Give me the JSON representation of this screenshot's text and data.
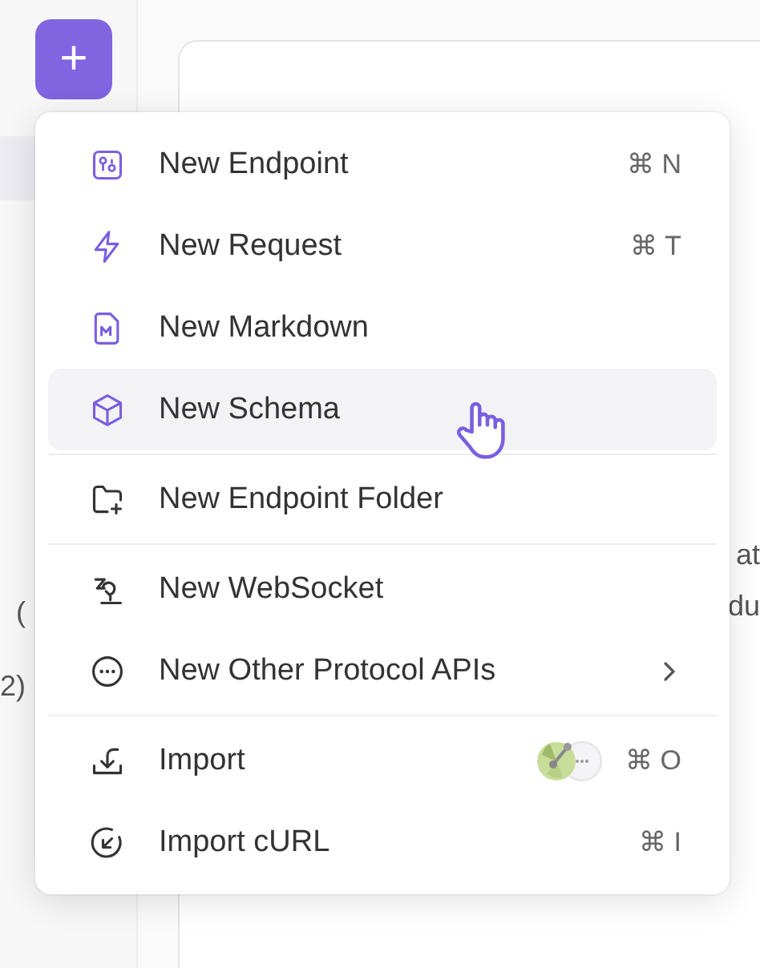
{
  "add_button": {
    "label": "+"
  },
  "overview": {
    "fragments": [
      "at",
      "du"
    ]
  },
  "sidebar": {
    "fragments": [
      "(",
      "2)"
    ]
  },
  "menu": {
    "groups": [
      {
        "items": [
          {
            "kind": "shortcut",
            "label": "New Endpoint",
            "shortcut": "⌘ N",
            "selected": false
          },
          {
            "kind": "shortcut",
            "label": "New Request",
            "shortcut": "⌘ T",
            "selected": false
          },
          {
            "kind": "plain",
            "label": "New Markdown",
            "selected": false
          },
          {
            "kind": "plain",
            "label": "New Schema",
            "selected": true
          }
        ]
      },
      {
        "items": [
          {
            "kind": "plain",
            "label": "New Endpoint Folder",
            "selected": false
          }
        ]
      },
      {
        "items": [
          {
            "kind": "plain",
            "label": "New WebSocket",
            "selected": false
          },
          {
            "kind": "submenu",
            "label": "New Other Protocol APIs",
            "selected": false
          }
        ]
      },
      {
        "items": [
          {
            "kind": "apps",
            "label": "Import",
            "shortcut": "⌘ O",
            "selected": false
          },
          {
            "kind": "shortcut",
            "label": "Import cURL",
            "shortcut": "⌘ I",
            "selected": false
          }
        ]
      }
    ]
  }
}
